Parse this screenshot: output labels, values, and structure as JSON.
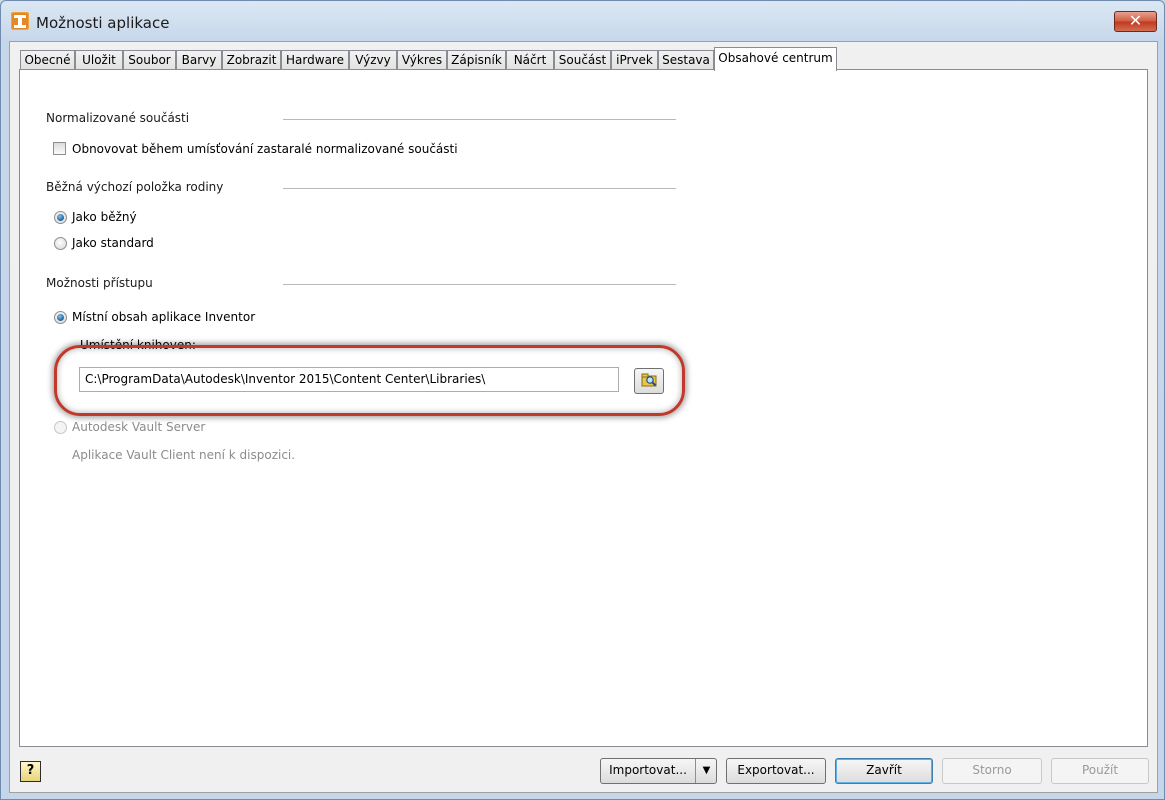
{
  "window": {
    "title": "Možnosti aplikace",
    "close_glyph": "✕"
  },
  "tabs": [
    {
      "label": "Obecné"
    },
    {
      "label": "Uložit"
    },
    {
      "label": "Soubor"
    },
    {
      "label": "Barvy"
    },
    {
      "label": "Zobrazit"
    },
    {
      "label": "Hardware"
    },
    {
      "label": "Výzvy"
    },
    {
      "label": "Výkres"
    },
    {
      "label": "Zápisník"
    },
    {
      "label": "Náčrt"
    },
    {
      "label": "Součást"
    },
    {
      "label": "iPrvek"
    },
    {
      "label": "Sestava"
    },
    {
      "label": "Obsahové centrum"
    }
  ],
  "active_tab": "Obsahové centrum",
  "sections": {
    "normalized": {
      "title": "Normalizované součásti",
      "checkbox_label": "Obnovovat během umísťování zastaralé normalizované součásti",
      "checked": false
    },
    "family": {
      "title": "Běžná výchozí položka rodiny",
      "options": [
        "Jako běžný",
        "Jako standard"
      ],
      "selected": "Jako běžný"
    },
    "access": {
      "title": "Možnosti přístupu",
      "local_label": "Místní obsah aplikace Inventor",
      "library_location_label": "Umístění knihoven:",
      "library_path": "C:\\ProgramData\\Autodesk\\Inventor 2015\\Content Center\\Libraries\\",
      "vault_label": "Autodesk Vault Server",
      "vault_note": "Aplikace Vault Client není k dispozici.",
      "selected": "Místní obsah aplikace Inventor"
    }
  },
  "footer": {
    "help_glyph": "?",
    "import_label": "Importovat...",
    "export_label": "Exportovat...",
    "close_label": "Zavřít",
    "cancel_label": "Storno",
    "apply_label": "Použít"
  },
  "colors": {
    "highlight_ring": "#c0392b",
    "radio_fill": "#1d5f9a"
  }
}
